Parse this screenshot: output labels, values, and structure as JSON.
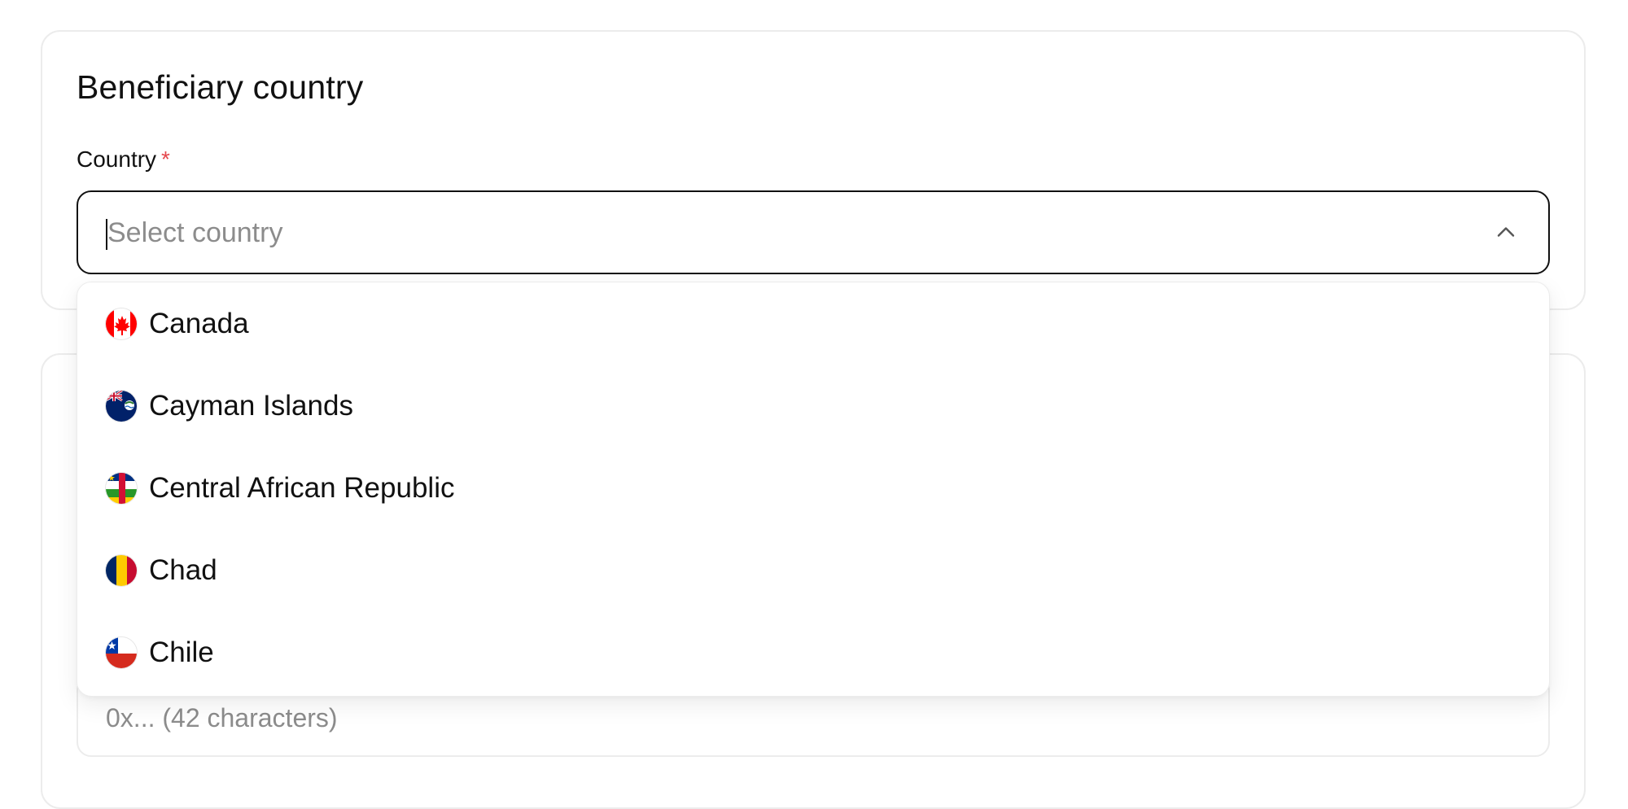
{
  "country_card": {
    "title": "Beneficiary country",
    "field_label": "Country",
    "required_mark": "*",
    "select": {
      "placeholder": "Select country",
      "value": "",
      "chevron_icon": "chevron-up-icon"
    },
    "dropdown": {
      "options": [
        {
          "label": "Canada",
          "flag_icon": "canada-flag-icon"
        },
        {
          "label": "Cayman Islands",
          "flag_icon": "cayman-islands-flag-icon"
        },
        {
          "label": "Central African Republic",
          "flag_icon": "central-african-republic-flag-icon"
        },
        {
          "label": "Chad",
          "flag_icon": "chad-flag-icon"
        },
        {
          "label": "Chile",
          "flag_icon": "chile-flag-icon"
        }
      ]
    }
  },
  "wallet_card": {
    "input": {
      "placeholder": "0x... (42 characters)",
      "value": ""
    }
  },
  "colors": {
    "required": "#e5484d",
    "border": "#ececec",
    "focus_border": "#111111",
    "placeholder": "#8c8c8c"
  }
}
